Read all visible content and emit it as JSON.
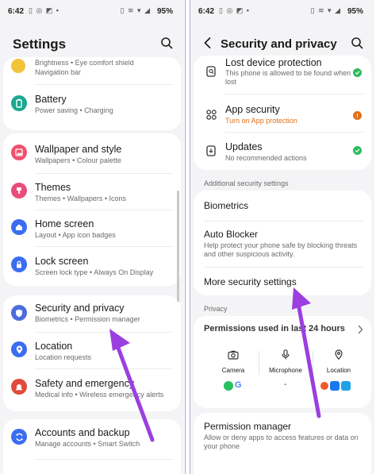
{
  "left": {
    "status": {
      "time": "6:42",
      "notif_icons": "▯ ◎ ◩ ▪",
      "sys_icons": "▯ ≋ ▾ ◢",
      "battery": "95%"
    },
    "title": "Settings",
    "items": [
      {
        "label": "Brightness • Eye comfort shield",
        "sub": "Navigation bar"
      },
      {
        "label": "Battery",
        "sub": "Power saving  •  Charging",
        "color": "#1aa88f",
        "icon": "battery-icon"
      },
      {
        "label": "Wallpaper and style",
        "sub": "Wallpapers  •  Colour palette",
        "color": "#f0506e",
        "icon": "wallpaper-icon"
      },
      {
        "label": "Themes",
        "sub": "Themes  •  Wallpapers  •  Icons",
        "color": "#ea4c7a",
        "icon": "themes-icon"
      },
      {
        "label": "Home screen",
        "sub": "Layout  •  App icon badges",
        "color": "#3a6df0",
        "icon": "home-icon"
      },
      {
        "label": "Lock screen",
        "sub": "Screen lock type  •  Always On Display",
        "color": "#3a6df0",
        "icon": "lock-icon"
      },
      {
        "label": "Security and privacy",
        "sub": "Biometrics  •  Permission manager",
        "color": "#4d6cdb",
        "icon": "shield-icon"
      },
      {
        "label": "Location",
        "sub": "Location requests",
        "color": "#3a6df0",
        "icon": "location-pin-icon"
      },
      {
        "label": "Safety and emergency",
        "sub": "Medical info  •  Wireless emergency alerts",
        "color": "#e14b3b",
        "icon": "emergency-icon"
      },
      {
        "label": "Accounts and backup",
        "sub": "Manage accounts  •  Smart Switch",
        "color": "#3a6df0",
        "icon": "sync-icon"
      }
    ]
  },
  "right": {
    "status": {
      "time": "6:42",
      "notif_icons": "▯ ◎ ◩ ▪",
      "sys_icons": "▯ ≋ ▾ ◢",
      "battery": "95%"
    },
    "title": "Security and privacy",
    "lost_device": {
      "label": "Lost device protection",
      "sub": "This phone is allowed to be found when lost"
    },
    "app_security": {
      "label": "App security",
      "sub": "Turn on App protection",
      "sub_color": "#e0701b"
    },
    "updates": {
      "label": "Updates",
      "sub": "No recommended actions"
    },
    "additional_header": "Additional security settings",
    "biometrics": "Biometrics",
    "auto_blocker": {
      "label": "Auto Blocker",
      "sub": "Help protect your phone safe by blocking threats and other suspicious activity."
    },
    "more_security": "More security settings",
    "privacy_header": "Privacy",
    "permissions_used": "Permissions used in last 24 hours",
    "perm_cols": [
      {
        "label": "Camera",
        "icon": "camera-icon"
      },
      {
        "label": "Microphone",
        "icon": "microphone-icon"
      },
      {
        "label": "Location",
        "icon": "location-pin-icon"
      }
    ],
    "mic_apps": "-",
    "permission_manager": {
      "label": "Permission manager",
      "sub": "Allow or deny apps to access features or data on your phone"
    }
  },
  "colors": {
    "accent_arrow": "#9b3fe0",
    "check_green": "#2fbc5f"
  }
}
